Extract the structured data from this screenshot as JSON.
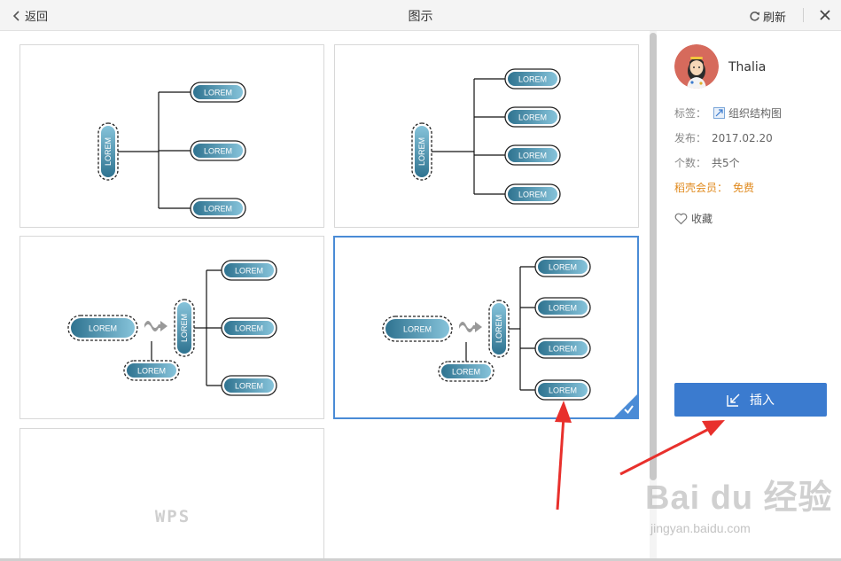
{
  "header": {
    "back_label": "返回",
    "title": "图示",
    "refresh_label": "刷新"
  },
  "templates": {
    "node_text": "LOREM",
    "placeholder_brand": "WPS",
    "cards": [
      {
        "id": 1,
        "selected": false
      },
      {
        "id": 2,
        "selected": false
      },
      {
        "id": 3,
        "selected": false
      },
      {
        "id": 4,
        "selected": true
      },
      {
        "id": 5,
        "selected": false
      }
    ]
  },
  "sidebar": {
    "author": "Thalia",
    "tag_label": "标签：",
    "tag_value": "组织结构图",
    "publish_label": "发布：",
    "publish_value": "2017.02.20",
    "count_label": "个数：",
    "count_value": "共5个",
    "member_label": "稻壳会员：",
    "member_value": "免费",
    "favorite_label": "收藏",
    "insert_label": "插入"
  },
  "watermark": {
    "brand": "Bai du 经验",
    "url": "jingyan.baidu.com"
  },
  "colors": {
    "accent": "#3b7bcf",
    "selected_border": "#4a8bd6",
    "member": "#e08a1e",
    "arrow": "#e8302c",
    "node_dark": "#2f7390",
    "node_light": "#86c3da"
  }
}
